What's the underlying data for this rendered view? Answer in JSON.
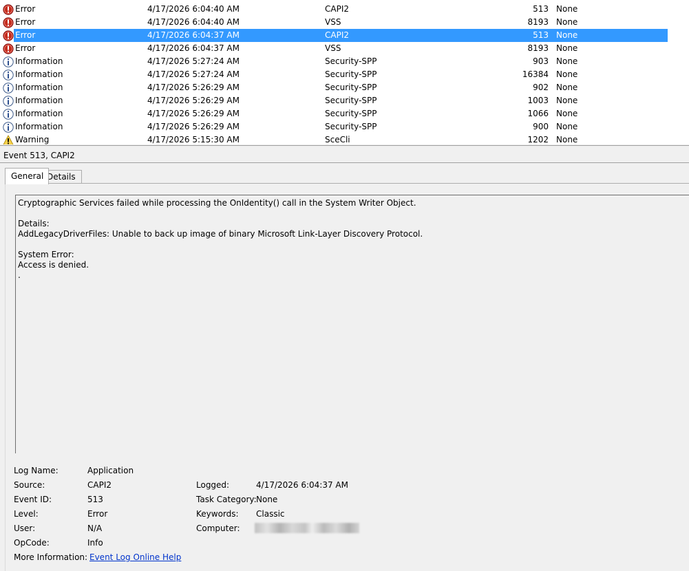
{
  "event_list": {
    "rows": [
      {
        "level": "Error",
        "level_icon": "error-icon",
        "date": "4/17/2026 6:04:40 AM",
        "source": "CAPI2",
        "event_id": "513",
        "task": "None"
      },
      {
        "level": "Error",
        "level_icon": "error-icon",
        "date": "4/17/2026 6:04:40 AM",
        "source": "VSS",
        "event_id": "8193",
        "task": "None"
      },
      {
        "level": "Error",
        "level_icon": "error-icon",
        "date": "4/17/2026 6:04:37 AM",
        "source": "CAPI2",
        "event_id": "513",
        "task": "None",
        "selected": true
      },
      {
        "level": "Error",
        "level_icon": "error-icon",
        "date": "4/17/2026 6:04:37 AM",
        "source": "VSS",
        "event_id": "8193",
        "task": "None"
      },
      {
        "level": "Information",
        "level_icon": "info-icon",
        "date": "4/17/2026 5:27:24 AM",
        "source": "Security-SPP",
        "event_id": "903",
        "task": "None"
      },
      {
        "level": "Information",
        "level_icon": "info-icon",
        "date": "4/17/2026 5:27:24 AM",
        "source": "Security-SPP",
        "event_id": "16384",
        "task": "None"
      },
      {
        "level": "Information",
        "level_icon": "info-icon",
        "date": "4/17/2026 5:26:29 AM",
        "source": "Security-SPP",
        "event_id": "902",
        "task": "None"
      },
      {
        "level": "Information",
        "level_icon": "info-icon",
        "date": "4/17/2026 5:26:29 AM",
        "source": "Security-SPP",
        "event_id": "1003",
        "task": "None"
      },
      {
        "level": "Information",
        "level_icon": "info-icon",
        "date": "4/17/2026 5:26:29 AM",
        "source": "Security-SPP",
        "event_id": "1066",
        "task": "None"
      },
      {
        "level": "Information",
        "level_icon": "info-icon",
        "date": "4/17/2026 5:26:29 AM",
        "source": "Security-SPP",
        "event_id": "900",
        "task": "None"
      },
      {
        "level": "Warning",
        "level_icon": "warning-icon",
        "date": "4/17/2026 5:15:30 AM",
        "source": "SceCli",
        "event_id": "1202",
        "task": "None"
      }
    ],
    "selection_color": "#3399ff"
  },
  "detail": {
    "title": "Event 513, CAPI2",
    "tabs": [
      {
        "label": "General",
        "active": true
      },
      {
        "label": "Details",
        "active": false
      }
    ],
    "description": "Cryptographic Services failed while processing the OnIdentity() call in the System Writer Object.\n\nDetails:\nAddLegacyDriverFiles: Unable to back up image of binary Microsoft Link-Layer Discovery Protocol.\n\nSystem Error:\nAccess is denied.\n.",
    "properties": {
      "log_name": {
        "label": "Log Name:",
        "value": "Application"
      },
      "source": {
        "label": "Source:",
        "value": "CAPI2"
      },
      "logged": {
        "label": "Logged:",
        "value": "4/17/2026 6:04:37 AM"
      },
      "event_id": {
        "label": "Event ID:",
        "value": "513"
      },
      "task_category": {
        "label": "Task Category:",
        "value": "None"
      },
      "level": {
        "label": "Level:",
        "value": "Error"
      },
      "keywords": {
        "label": "Keywords:",
        "value": "Classic"
      },
      "user": {
        "label": "User:",
        "value": "N/A"
      },
      "computer": {
        "label": "Computer:",
        "value": ""
      },
      "opcode": {
        "label": "OpCode:",
        "value": "Info"
      },
      "more_info": {
        "label": "More Information:",
        "value": "Event Log Online Help"
      }
    },
    "link_color": "#0033cc"
  }
}
